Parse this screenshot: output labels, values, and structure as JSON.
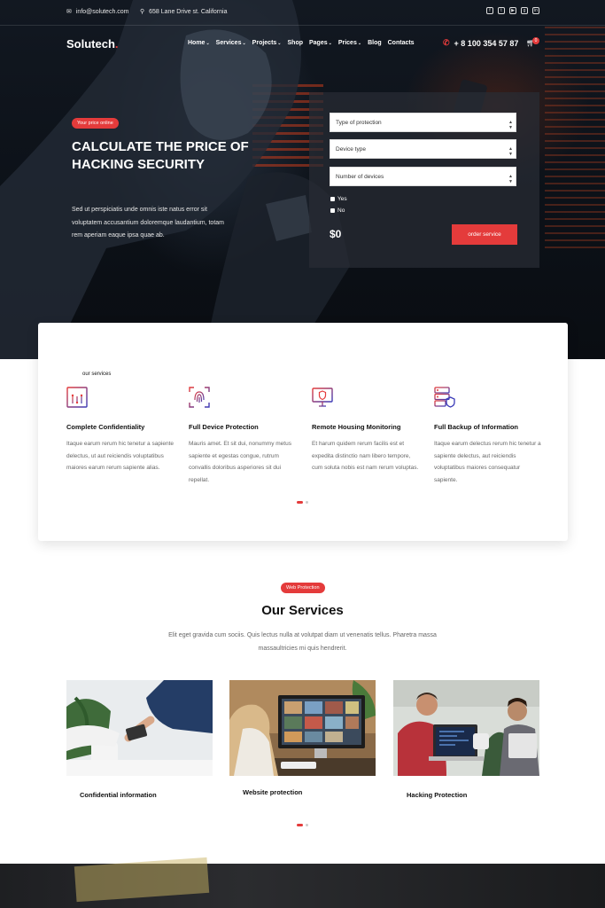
{
  "topbar": {
    "email": "info@solutech.com",
    "address": "658 Lane Drive st. California",
    "socials": [
      "facebook-icon",
      "twitter-icon",
      "youtube-icon",
      "github-icon",
      "linkedin-icon"
    ]
  },
  "header": {
    "logo": "Solutech",
    "logo_dot": ".",
    "nav": [
      {
        "label": "Home",
        "dropdown": true
      },
      {
        "label": "Services",
        "dropdown": true
      },
      {
        "label": "Projects",
        "dropdown": true
      },
      {
        "label": "Shop",
        "dropdown": false
      },
      {
        "label": "Pages",
        "dropdown": true
      },
      {
        "label": "Prices",
        "dropdown": true
      },
      {
        "label": "Blog",
        "dropdown": false
      },
      {
        "label": "Contacts",
        "dropdown": false
      }
    ],
    "phone": "+ 8 100 354 57 87",
    "cart_count": "0"
  },
  "hero": {
    "badge": "Your price online",
    "title": "Calculate the price of hacking security",
    "text": "Sed ut perspiciatis unde omnis iste natus error sit voluptatem accusantium doloremque laudantium, totam rem aperiam eaque ipsa quae ab."
  },
  "calculator": {
    "selects": [
      "Type of protection",
      "Device type",
      "Number of devices"
    ],
    "radios": [
      "Yes",
      "No"
    ],
    "price": "$0",
    "order_button": "order service"
  },
  "services_card": {
    "label": "our services",
    "items": [
      {
        "title": "Complete Confidentiality",
        "text": "Itaque earum rerum hic tenetur a sapiente delectus, ut aut reiciendis voluptatibus maiores earum rerum sapiente alias.",
        "icon": "browser-code-icon"
      },
      {
        "title": "Full Device Protection",
        "text": "Mauris amet. Et sit dui, nonummy metus sapiente et egestas congue, rutrum convallis doloribus asperiores sit dui repellat.",
        "icon": "fingerprint-icon"
      },
      {
        "title": "Remote Housing Monitoring",
        "text": "Et harum quidem rerum facilis est et expedita distinctio nam libero tempore, cum soluta nobis est nam rerum voluptas.",
        "icon": "monitor-shield-icon"
      },
      {
        "title": "Full Backup of Information",
        "text": "Itaque earum delectus rerum hic tenetur a sapiente delectus, aut reiciendis voluptatibus maiores consequatur sapiente.",
        "icon": "server-shield-icon"
      }
    ]
  },
  "our_services": {
    "badge": "Web Protection",
    "title": "Our Services",
    "subtitle": "Elit eget gravida cum sociis. Quis lectus nulla at volutpat diam ut venenatis tellus. Pharetra massa massaultricies mi quis hendrerit.",
    "cards": [
      {
        "caption": "Confidential information"
      },
      {
        "caption": "Website protection"
      },
      {
        "caption": "Hacking Protection"
      }
    ]
  },
  "colors": {
    "accent": "#e43b3b",
    "hero_bg": "#0f141b",
    "text_dark": "#111111"
  }
}
